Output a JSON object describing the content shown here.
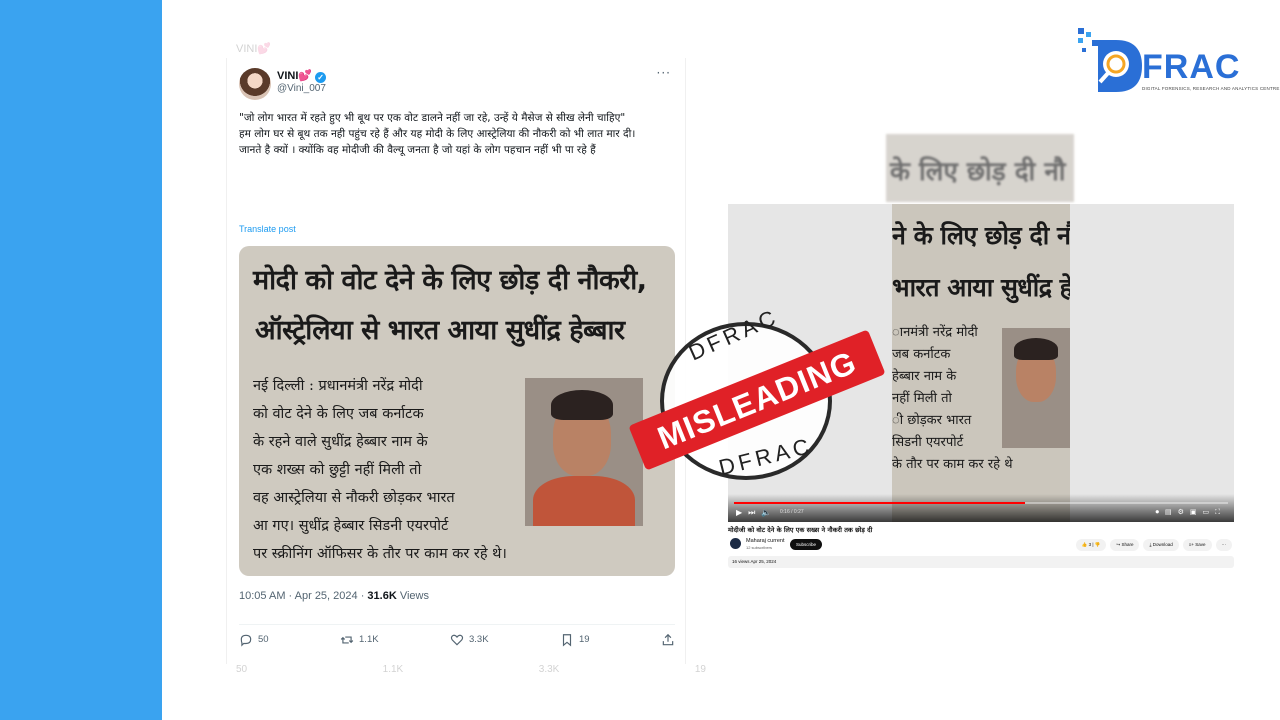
{
  "logo": {
    "name": "FRAC",
    "subtitle": "DIGITAL FORENSICS, RESEARCH AND ANALYTICS CENTRE"
  },
  "tweet": {
    "display_name": "VINI💕",
    "handle": "@Vini_007",
    "text_lines": [
      "\"जो लोग भारत में रहते हुए भी बूथ पर एक वोट डालने नहीं जा रहे, उन्हें ये मैसेज से सीख लेनी चाहिए\"",
      "हम लोग घर से बूथ तक नही पहुंच रहे हैं और यह मोदी के लिए आस्ट्रेलिया की नौकरी को भी लात मार दी।",
      "जानते है क्यों । क्योंकि वह मोदीजी की वैल्यू जनता है जो यहां के लोग पहचान नहीं भी पा रहे हैं"
    ],
    "translate_label": "Translate post",
    "timestamp": "10:05 AM · Apr 25, 2024 · ",
    "views_count": "31.6K",
    "views_label": " Views",
    "replies": "50",
    "reposts": "1.1K",
    "likes": "3.3K",
    "bookmarks": "19"
  },
  "clipping": {
    "headline1": "मोदी को वोट देने के लिए छोड़ दी नौकरी,",
    "headline2": "ऑस्ट्रेलिया से भारत आया सुधींद्र हेब्बार",
    "body_lines": [
      "नई दिल्ली : प्रधानमंत्री नरेंद्र मोदी",
      "को वोट देने के लिए जब  कर्नाटक",
      "के रहने वाले सुधींद्र हेब्बार नाम के",
      "एक शख्स को छुट्टी नहीं मिली तो",
      "वह आस्ट्रेलिया से नौकरी छोड़कर भारत",
      "आ गए। सुधींद्र हेब्बार सिडनी एयरपोर्ट",
      "पर स्क्रीनिंग ऑफिसर के तौर पर काम कर रहे थे।"
    ]
  },
  "youtube": {
    "blur_text": "के लिए छोड़ दी नौ",
    "frame_h1": "ने के लिए छोड़ दी नौ",
    "frame_h2": "भारत आया सुधींद्र हे",
    "frame_body": [
      "ानमंत्री नरेंद्र मोदी",
      "जब  कर्नाटक",
      "हेब्बार नाम के",
      "नहीं मिली तो",
      "ी छोड़कर भारत",
      "सिडनी एयरपोर्ट",
      "के तौर पर काम कर रहे थे"
    ],
    "time": "0:16 / 0:27",
    "progress": 0.59,
    "title": "मोदीजी को वोट देने के लिए एक सख्स ने नौकरी तक छोड़ दी",
    "channel": "Maharaj current",
    "subscribers": "12 subscribers",
    "subscribe_label": "Subscribe",
    "like_count": "3",
    "share_label": "Share",
    "download_label": "Download",
    "save_label": "Save",
    "description": "16 views  Apr 25, 2024"
  },
  "stamp": {
    "label": "MISLEADING",
    "ring_top": "DFRAC",
    "ring_bottom": "DFRAC"
  },
  "colors": {
    "side_bar": "#3aa3f0",
    "stamp_red": "#e02127",
    "brand_blue": "#2a6fd6",
    "link_blue": "#1d9bf0"
  }
}
